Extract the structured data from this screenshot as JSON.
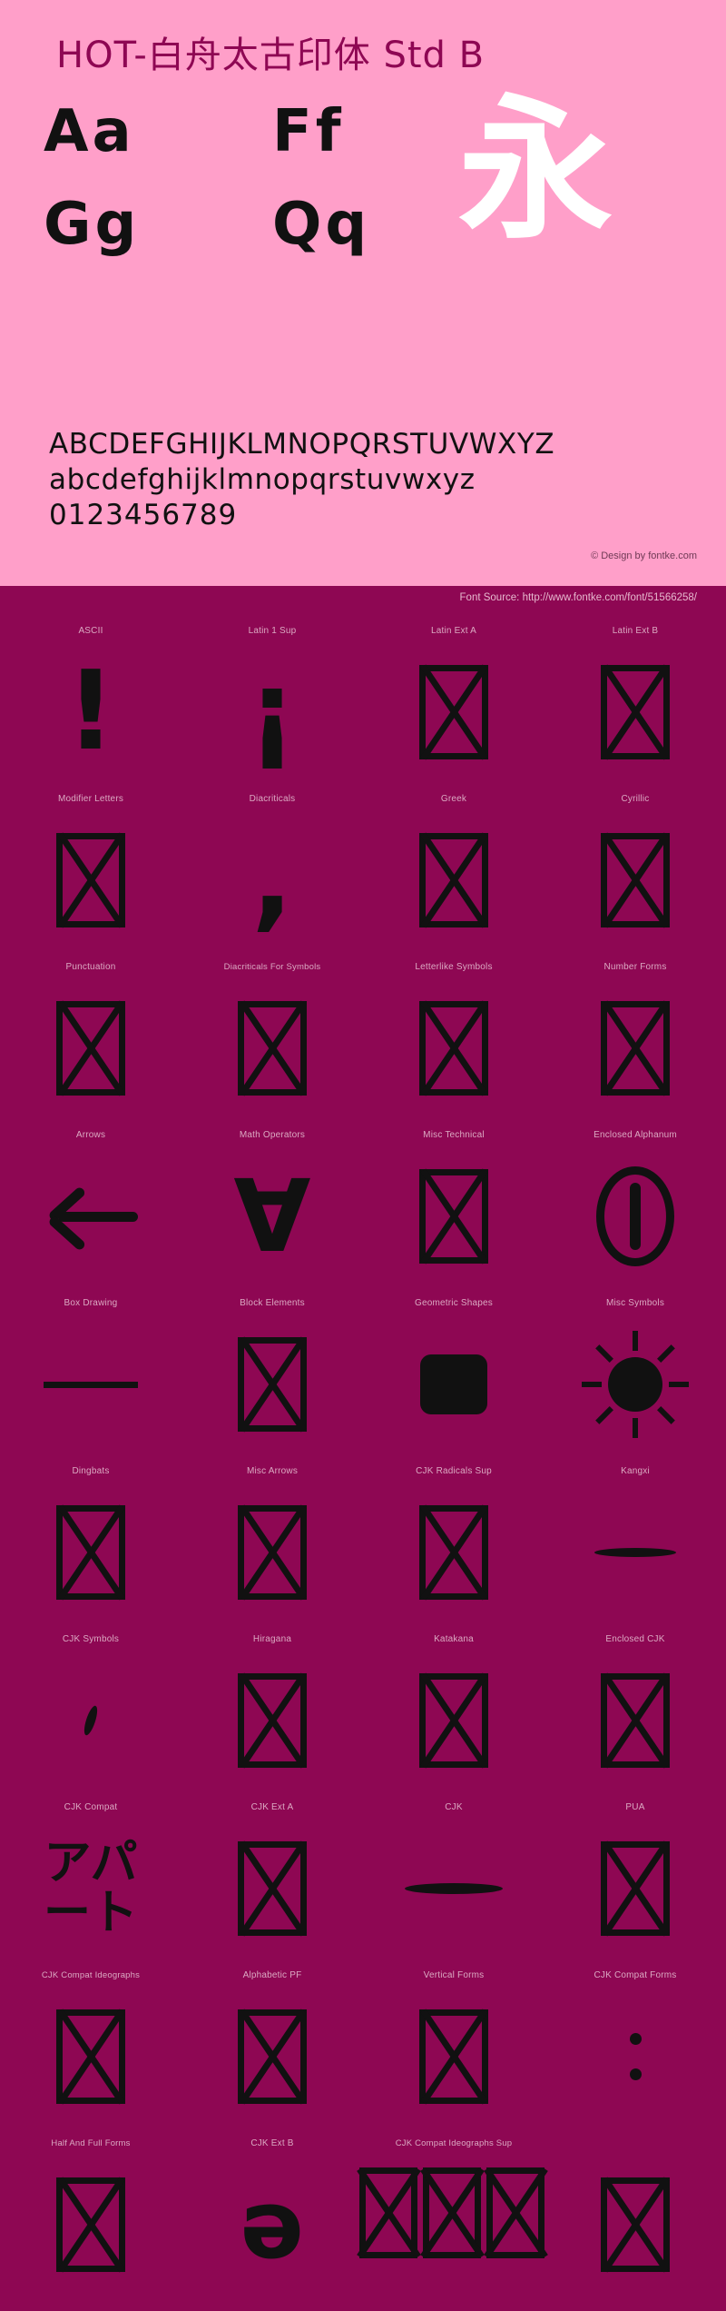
{
  "specimen": {
    "title": "HOT-白舟太古印体 Std B",
    "glyph_pairs": [
      "Aa",
      "Ff",
      "Gg",
      "Qq"
    ],
    "cjk_sample": "永",
    "uppercase": "ABCDEFGHIJKLMNOPQRSTUVWXYZ",
    "lowercase": "abcdefghijklmnopqrstuvwxyz",
    "digits": "0123456789",
    "credit": "© Design by fontke.com",
    "colors": {
      "panel_bg": "#ff9fc9",
      "title": "#8e0753",
      "glyph": "#111111",
      "cjk_sample": "#ffffff"
    }
  },
  "source_bar": {
    "text": "Font Source: http://www.fontke.com/font/51566258/",
    "bg": "#8e0753",
    "color": "#e7b9cf"
  },
  "coverage": {
    "bg": "#8e0753",
    "label_color": "#dba9c2",
    "rows": [
      [
        {
          "label": "ASCII",
          "glyph": "!",
          "kind": "glyph"
        },
        {
          "label": "Latin 1 Sup",
          "glyph": "¡",
          "kind": "glyph"
        },
        {
          "label": "Latin Ext A",
          "glyph": "",
          "kind": "notdef"
        },
        {
          "label": "Latin Ext B",
          "glyph": "",
          "kind": "notdef"
        }
      ],
      [
        {
          "label": "Modifier Letters",
          "glyph": "",
          "kind": "notdef"
        },
        {
          "label": "Diacriticals",
          "glyph": ",",
          "kind": "glyph"
        },
        {
          "label": "Greek",
          "glyph": "",
          "kind": "notdef"
        },
        {
          "label": "Cyrillic",
          "glyph": "",
          "kind": "notdef"
        }
      ],
      [
        {
          "label": "Punctuation",
          "glyph": "",
          "kind": "notdef"
        },
        {
          "label": "Diacriticals For Symbols",
          "glyph": "",
          "kind": "notdef"
        },
        {
          "label": "Letterlike Symbols",
          "glyph": "",
          "kind": "notdef"
        },
        {
          "label": "Number Forms",
          "glyph": "",
          "kind": "notdef"
        }
      ],
      [
        {
          "label": "Arrows",
          "glyph": "←",
          "kind": "arrow"
        },
        {
          "label": "Math Operators",
          "glyph": "∀",
          "kind": "glyph"
        },
        {
          "label": "Misc Technical",
          "glyph": "",
          "kind": "notdef"
        },
        {
          "label": "Enclosed Alphanum",
          "glyph": "①",
          "kind": "circled"
        }
      ],
      [
        {
          "label": "Box Drawing",
          "glyph": "─",
          "kind": "hline"
        },
        {
          "label": "Block Elements",
          "glyph": "",
          "kind": "notdef"
        },
        {
          "label": "Geometric Shapes",
          "glyph": "■",
          "kind": "blob"
        },
        {
          "label": "Misc Symbols",
          "glyph": "☀",
          "kind": "sun"
        }
      ],
      [
        {
          "label": "Dingbats",
          "glyph": "",
          "kind": "notdef"
        },
        {
          "label": "Misc Arrows",
          "glyph": "",
          "kind": "notdef"
        },
        {
          "label": "CJK Radicals Sup",
          "glyph": "",
          "kind": "notdef"
        },
        {
          "label": "Kangxi",
          "glyph": "一",
          "kind": "bar"
        }
      ],
      [
        {
          "label": "CJK Symbols",
          "glyph": "、",
          "kind": "tick"
        },
        {
          "label": "Hiragana",
          "glyph": "",
          "kind": "notdef"
        },
        {
          "label": "Katakana",
          "glyph": "",
          "kind": "notdef"
        },
        {
          "label": "Enclosed CJK",
          "glyph": "",
          "kind": "notdef"
        }
      ],
      [
        {
          "label": "CJK Compat",
          "glyph": "アパート",
          "kind": "kana"
        },
        {
          "label": "CJK Ext A",
          "glyph": "",
          "kind": "notdef"
        },
        {
          "label": "CJK",
          "glyph": "一",
          "kind": "bar"
        },
        {
          "label": "PUA",
          "glyph": "",
          "kind": "notdef"
        }
      ],
      [
        {
          "label": "CJK Compat Ideographs",
          "glyph": "",
          "kind": "notdef"
        },
        {
          "label": "Alphabetic PF",
          "glyph": "",
          "kind": "notdef"
        },
        {
          "label": "Vertical Forms",
          "glyph": "",
          "kind": "notdef"
        },
        {
          "label": "CJK Compat Forms",
          "glyph": "⋮",
          "kind": "dots"
        }
      ],
      [
        {
          "label": "Half And Full Forms",
          "glyph": "",
          "kind": "notdef"
        },
        {
          "label": "CJK Ext B",
          "glyph": "ə",
          "kind": "schwa"
        },
        {
          "label": "CJK Compat Ideographs Sup",
          "glyph": "",
          "kind": "notdef-group"
        },
        {
          "label": "",
          "glyph": "",
          "kind": "notdef"
        }
      ]
    ]
  }
}
